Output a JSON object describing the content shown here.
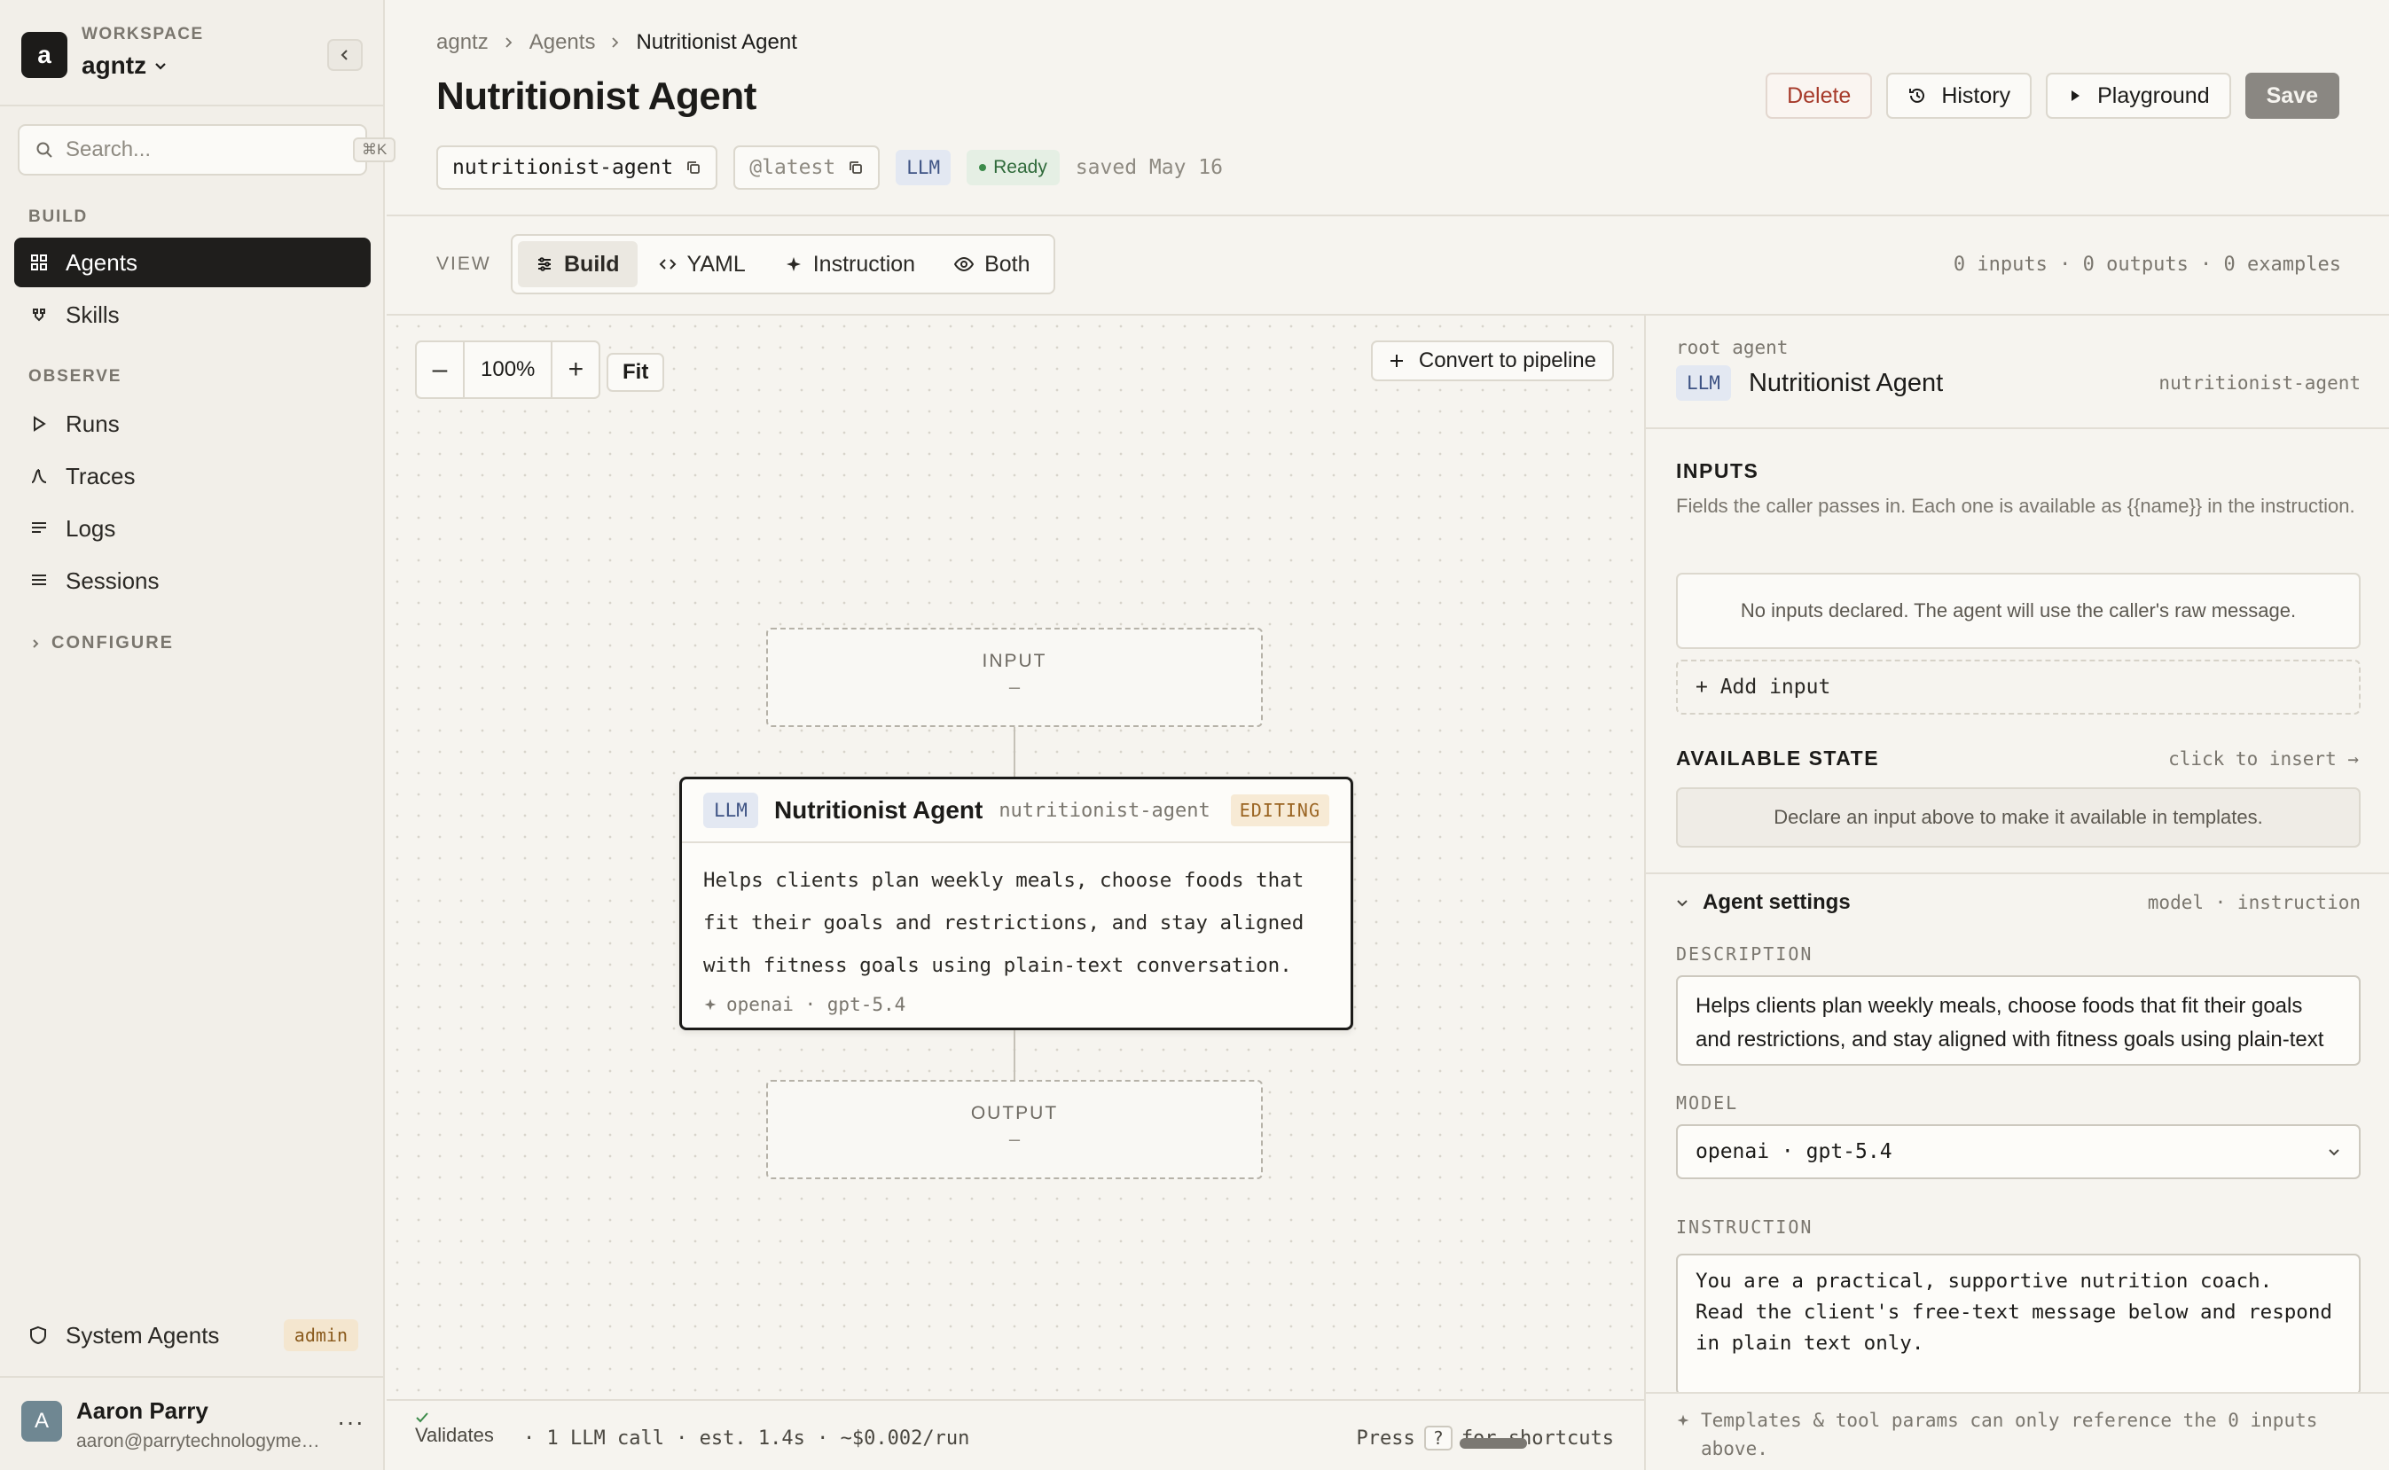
{
  "workspace": {
    "label": "WORKSPACE",
    "name": "agntz",
    "logo_letter": "a"
  },
  "search": {
    "placeholder": "Search...",
    "shortcut": "⌘K"
  },
  "nav": {
    "build_label": "BUILD",
    "build_items": [
      {
        "label": "Agents",
        "active": true
      },
      {
        "label": "Skills"
      }
    ],
    "observe_label": "OBSERVE",
    "observe_items": [
      {
        "label": "Runs"
      },
      {
        "label": "Traces"
      },
      {
        "label": "Logs"
      },
      {
        "label": "Sessions"
      }
    ],
    "configure_label": "CONFIGURE"
  },
  "system_agents": {
    "label": "System Agents",
    "badge": "admin"
  },
  "user": {
    "initial": "A",
    "name": "Aaron Parry",
    "email": "aaron@parrytechnologyme…"
  },
  "breadcrumb": [
    "agntz",
    "Agents",
    "Nutritionist Agent"
  ],
  "page": {
    "title": "Nutritionist Agent",
    "slug": "nutritionist-agent",
    "version": "@latest",
    "type_badge": "LLM",
    "status": "Ready",
    "saved": "saved May 16"
  },
  "actions": {
    "delete": "Delete",
    "history": "History",
    "playground": "Playground",
    "save": "Save"
  },
  "view": {
    "label": "VIEW",
    "tabs": [
      {
        "label": "Build",
        "active": true
      },
      {
        "label": "YAML"
      },
      {
        "label": "Instruction"
      },
      {
        "label": "Both"
      }
    ],
    "counts": "0 inputs · 0 outputs · 0 examples"
  },
  "canvas": {
    "zoom_out": "–",
    "zoom": "100%",
    "zoom_in": "+",
    "fit": "Fit",
    "convert": "Convert to pipeline",
    "input_node": {
      "title": "INPUT",
      "value": "–"
    },
    "output_node": {
      "title": "OUTPUT",
      "value": "–"
    },
    "agent_node": {
      "badge": "LLM",
      "name": "Nutritionist Agent",
      "slug": "nutritionist-agent",
      "state": "EDITING",
      "description": "Helps clients plan weekly meals, choose foods that fit their goals and restrictions, and stay aligned with fitness goals using plain-text conversation.",
      "model": "openai · gpt-5.4"
    }
  },
  "status_bar": {
    "validates": "Validates",
    "meta": "· 1 LLM call · est. 1.4s · ~$0.002/run",
    "press": "Press",
    "key": "?",
    "shortcuts": "for shortcuts"
  },
  "panel": {
    "root_label": "root agent",
    "root_badge": "LLM",
    "root_name": "Nutritionist Agent",
    "root_slug": "nutritionist-agent",
    "inputs_heading": "INPUTS",
    "inputs_help": "Fields the caller passes in. Each one is available as {{name}} in the instruction.",
    "inputs_empty": "No inputs declared. The agent will use the caller's raw message.",
    "add_input": "+ Add input",
    "state_heading": "AVAILABLE STATE",
    "state_hint": "click to insert →",
    "state_empty": "Declare an input above to make it available in templates.",
    "settings_title": "Agent settings",
    "settings_meta": "model · instruction",
    "description_label": "DESCRIPTION",
    "description": "Helps clients plan weekly meals, choose foods that fit their goals and restrictions, and stay aligned with fitness goals using plain-text conversation.",
    "model_label": "MODEL",
    "model": "openai · gpt-5.4",
    "instruction_label": "INSTRUCTION",
    "instruction_lines": [
      "You are a practical, supportive nutrition coach.",
      "",
      "Read the client's free-text message below and respond",
      "in plain text only."
    ],
    "footer_note": "Templates & tool params can only reference the 0 inputs above."
  }
}
